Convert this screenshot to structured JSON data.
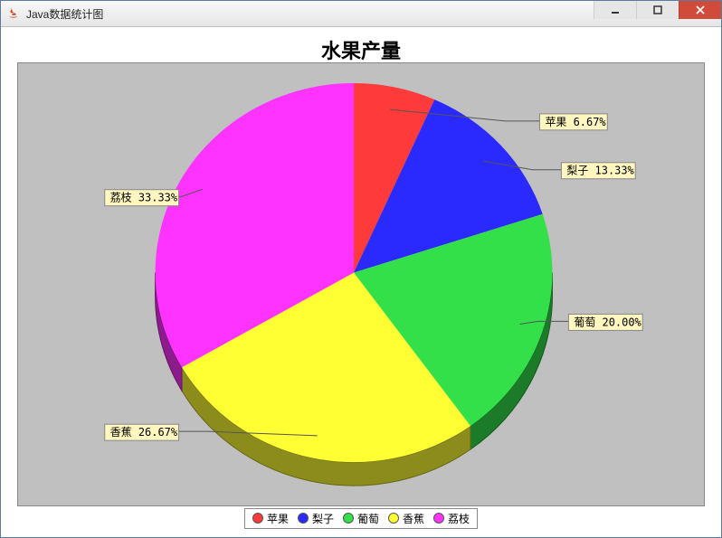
{
  "window": {
    "title": "Java数据统计图",
    "buttons": {
      "minimize": "–",
      "maximize": "□",
      "close": "×"
    }
  },
  "chart": {
    "title": "水果产量"
  },
  "chart_data": {
    "type": "pie",
    "title": "水果产量",
    "series": [
      {
        "name": "苹果",
        "value": 6.67,
        "color": "#ff3a3a",
        "label": "苹果  6.67%"
      },
      {
        "name": "梨子",
        "value": 13.33,
        "color": "#2a2aff",
        "label": "梨子  13.33%"
      },
      {
        "name": "葡萄",
        "value": 20.0,
        "color": "#33e04a",
        "label": "葡萄  20.00%"
      },
      {
        "name": "香蕉",
        "value": 26.67,
        "color": "#ffff33",
        "label": "香蕉  26.67%"
      },
      {
        "name": "荔枝",
        "value": 33.33,
        "color": "#ff33ff",
        "label": "荔枝  33.33%"
      }
    ],
    "legend": [
      "苹果",
      "梨子",
      "葡萄",
      "香蕉",
      "荔枝"
    ]
  }
}
